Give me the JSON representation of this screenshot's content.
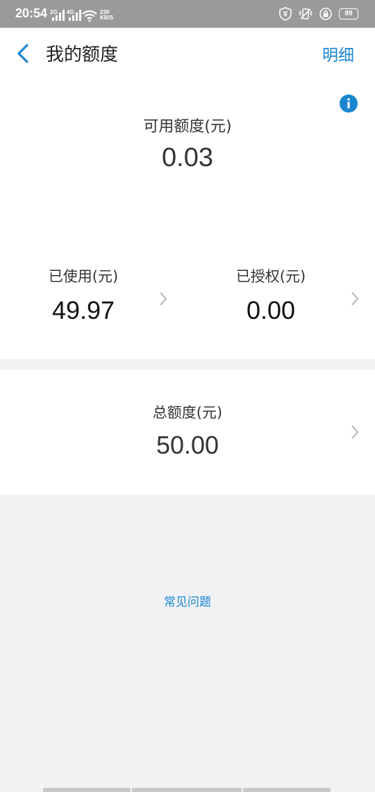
{
  "status_bar": {
    "time": "20:54",
    "sig1_label": "2G",
    "sig2_label": "4G",
    "net_speed_value": "230",
    "net_speed_unit": "KB/S",
    "battery": "89"
  },
  "header": {
    "title": "我的额度",
    "detail_link": "明细"
  },
  "available": {
    "label": "可用额度(元)",
    "value": "0.03"
  },
  "used": {
    "label": "已使用(元)",
    "value": "49.97"
  },
  "authorized": {
    "label": "已授权(元)",
    "value": "0.00"
  },
  "total": {
    "label": "总额度(元)",
    "value": "50.00"
  },
  "faq": {
    "label": "常见问题"
  },
  "colors": {
    "accent": "#1a86d0",
    "page_bg": "#f2f2f5",
    "status_bar_bg": "#9a9a9a"
  },
  "icons": [
    "back-arrow-icon",
    "info-icon",
    "chevron-right-icon",
    "wifi-icon",
    "shield-icon",
    "vibrate-icon",
    "lock-icon",
    "battery-icon"
  ]
}
